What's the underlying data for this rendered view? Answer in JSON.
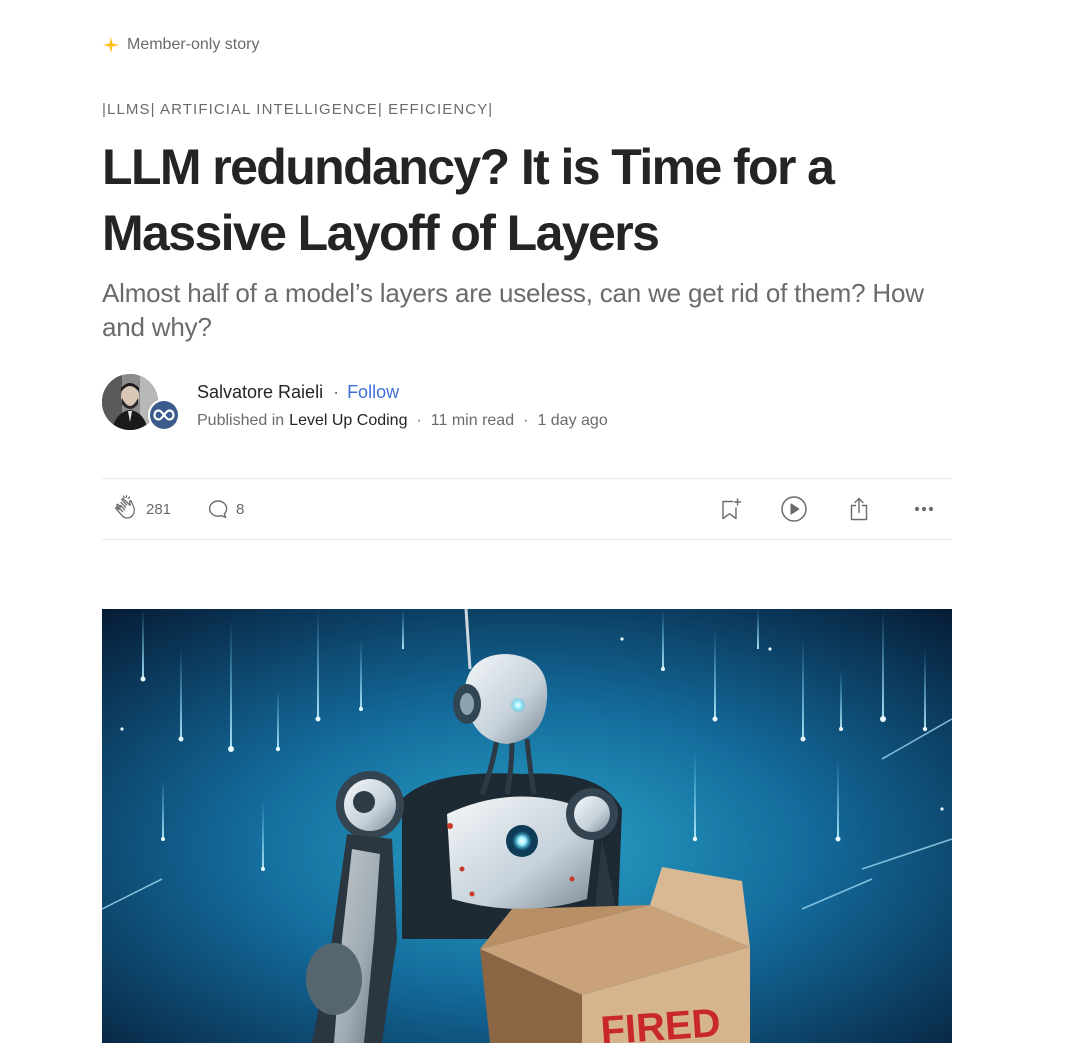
{
  "member_badge": {
    "label": "Member-only story",
    "accent": "#ffc017"
  },
  "tags": "|LLMS| ARTIFICIAL INTELLIGENCE| EFFICIENCY|",
  "title": "LLM redundancy? It is Time for a Massive Layoff of Layers",
  "subtitle": "Almost half of a model’s layers are useless, can we get rid of them? How and why?",
  "author": {
    "name": "Salvatore Raieli",
    "separator": "·",
    "follow_label": "Follow",
    "published_in_label": "Published in",
    "publication": "Level Up Coding",
    "read_time": "11 min read",
    "posted": "1 day ago"
  },
  "actions": {
    "claps": "281",
    "responses": "8",
    "icons": [
      "clap-icon",
      "comment-icon",
      "bookmark-icon",
      "play-icon",
      "share-icon",
      "more-icon"
    ]
  },
  "hero_image": {
    "box_label": "FIRED"
  },
  "colors": {
    "follow": "#3f6fd8",
    "text": "#242424",
    "muted": "#6b6b6b"
  }
}
